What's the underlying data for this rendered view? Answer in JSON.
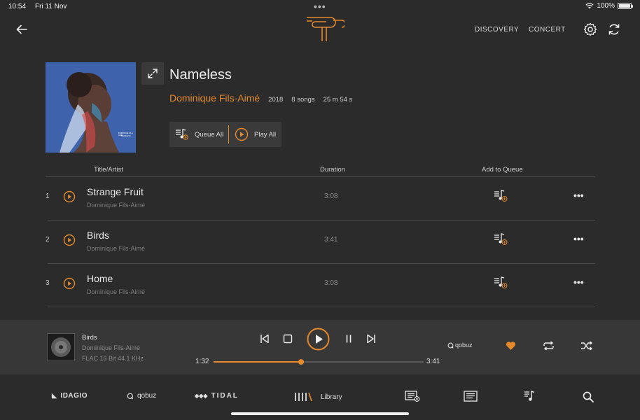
{
  "status_bar": {
    "time": "10:54",
    "date": "Fri 11 Nov",
    "battery": "100%"
  },
  "header": {
    "nav": [
      "DISCOVERY",
      "CONCERT"
    ]
  },
  "album": {
    "title": "Nameless",
    "artist": "Dominique Fils-Aimé",
    "year": "2018",
    "songs": "8 songs",
    "length": "25 m 54 s",
    "cover_small_text_1": "DOMINIQUE FILS-AIMÉ",
    "cover_small_text_2": "NAMELESS"
  },
  "actions": {
    "queue_all": "Queue All",
    "play_all": "Play All"
  },
  "table": {
    "headers": {
      "title": "Title/Artist",
      "duration": "Duration",
      "add": "Add to Queue"
    },
    "rows": [
      {
        "num": "1",
        "title": "Strange Fruit",
        "artist": "Dominique Fils-Aimé",
        "duration": "3:08"
      },
      {
        "num": "2",
        "title": "Birds",
        "artist": "Dominique Fils-Aimé",
        "duration": "3:41"
      },
      {
        "num": "3",
        "title": "Home",
        "artist": "Dominique Fils-Aimé",
        "duration": "3:08"
      }
    ]
  },
  "now_playing": {
    "title": "Birds",
    "artist": "Dominique Fils-Aimé",
    "format": "FLAC 16 Bit 44.1 KHz",
    "elapsed": "1:32",
    "total": "3:41",
    "progress": 0.416,
    "source": "qobuz"
  },
  "bottom_nav": {
    "idagio": "IDAGIO",
    "qobuz": "qobuz",
    "tidal": "TIDAL",
    "library": "Library"
  },
  "colors": {
    "accent": "#e48a2c",
    "background": "#2b2b2b",
    "player_bg": "#373737"
  },
  "icons": [
    "back-arrow-icon",
    "logo-icon",
    "gear-icon",
    "refresh-icon",
    "expand-icon",
    "queue-icon",
    "play-circle-icon",
    "more-icon",
    "prev-icon",
    "stop-icon",
    "pause-icon",
    "next-icon",
    "heart-icon",
    "repeat-icon",
    "shuffle-icon",
    "search-icon"
  ]
}
